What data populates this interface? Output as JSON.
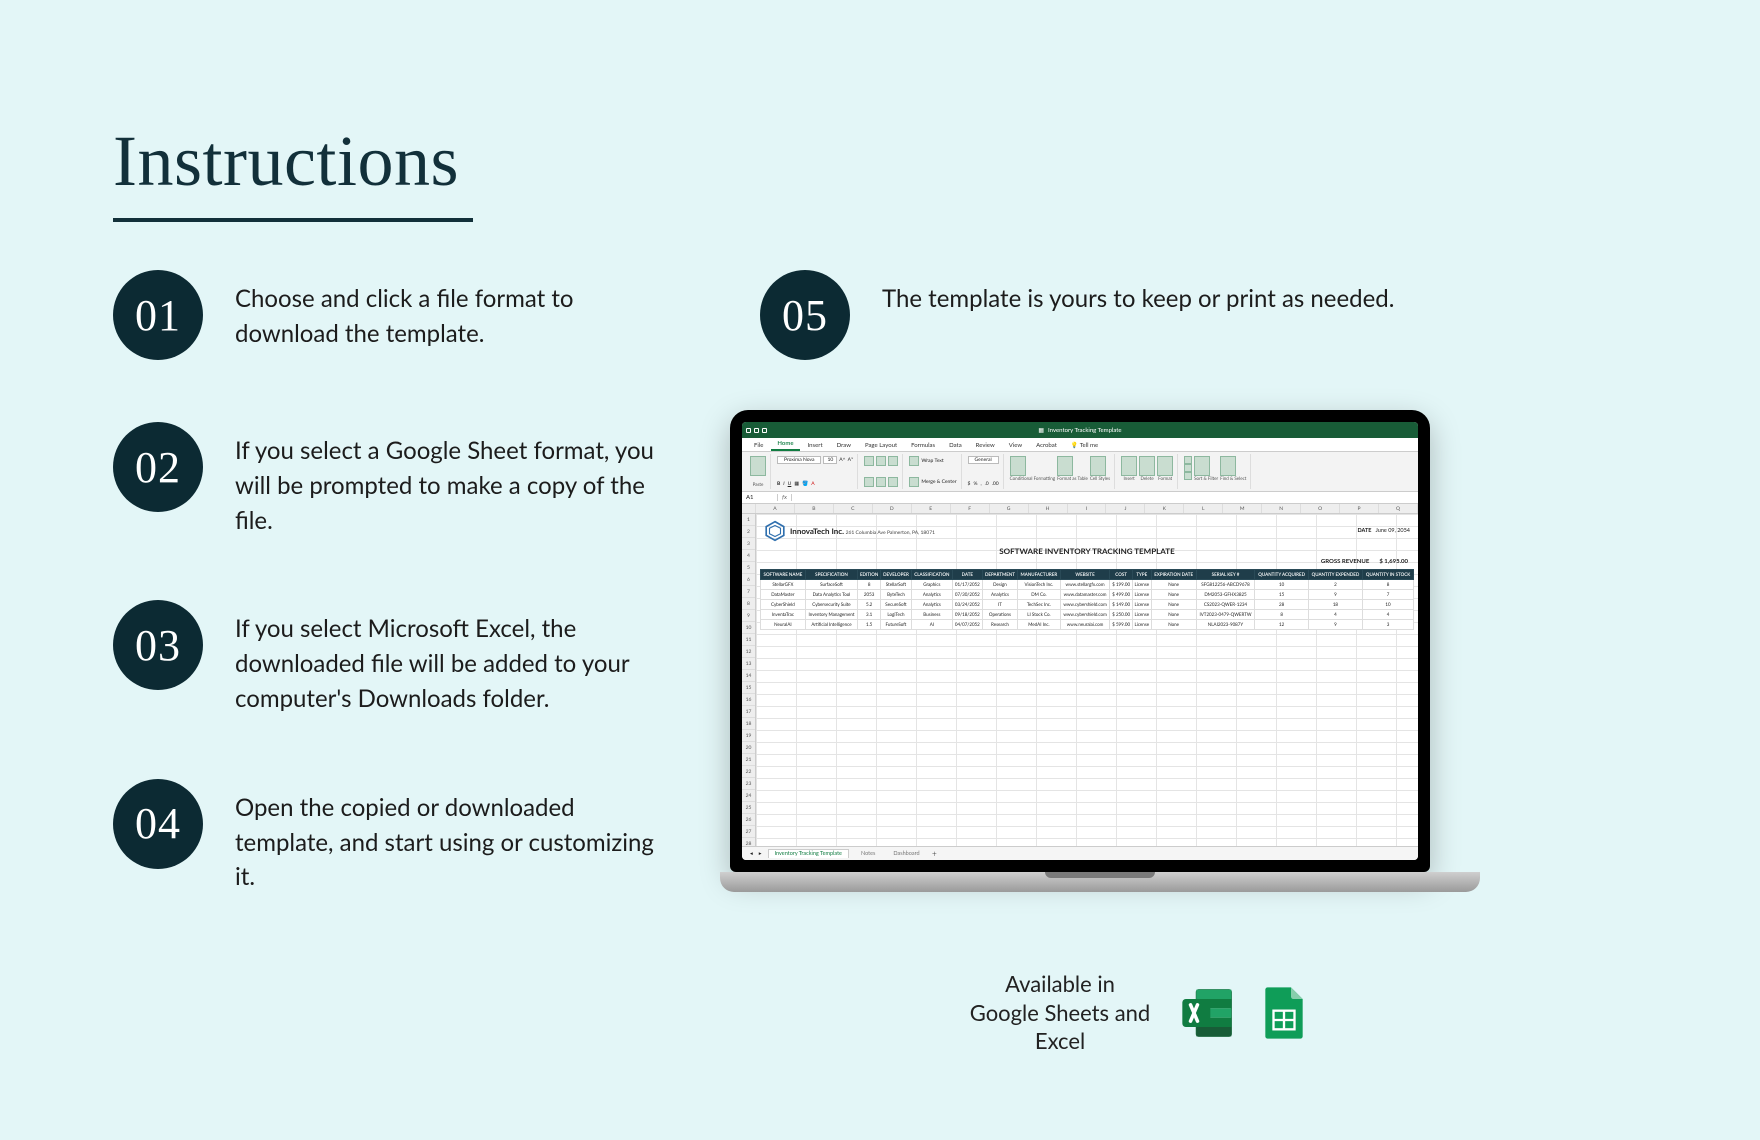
{
  "title": "Instructions",
  "steps": [
    {
      "num": "01",
      "text": "Choose and click a file format to download the template."
    },
    {
      "num": "02",
      "text": "If you select a Google Sheet format, you will be prompted to make a copy of the file."
    },
    {
      "num": "03",
      "text": "If you select Microsoft Excel, the downloaded file will be added to your computer's Downloads folder."
    },
    {
      "num": "04",
      "text": "Open the copied or downloaded template, and start using or customizing it."
    },
    {
      "num": "05",
      "text": "The template is yours to keep or print as needed."
    }
  ],
  "availability": {
    "text_line1": "Available in",
    "text_line2": "Google Sheets and Excel"
  },
  "excel": {
    "window_title": "Inventory Tracking Template",
    "tabs": [
      "File",
      "Home",
      "Insert",
      "Draw",
      "Page Layout",
      "Formulas",
      "Data",
      "Review",
      "View",
      "Acrobat"
    ],
    "tellme": "Tell me",
    "font_name": "Proxima Nova",
    "font_size": "10",
    "ribbon_labels": {
      "paste": "Paste",
      "wrap": "Wrap Text",
      "merge": "Merge & Center",
      "general": "General",
      "cond": "Conditional Formatting",
      "fmt_tbl": "Format as Table",
      "styles": "Cell Styles",
      "insert": "Insert",
      "delete": "Delete",
      "format": "Format",
      "sort": "Sort & Filter",
      "find": "Find & Select"
    },
    "name_box": "A1",
    "cols": [
      "A",
      "B",
      "C",
      "D",
      "E",
      "F",
      "G",
      "H",
      "I",
      "J",
      "K",
      "L",
      "M",
      "N",
      "O",
      "P",
      "Q"
    ],
    "sheet_tabs": [
      "Inventory Tracking Template",
      "Notes",
      "Dashboard"
    ],
    "doc": {
      "company": "InnovaTech Inc.",
      "address": "261 Columbia Ave Palmerton, PA, 18071",
      "date_label": "DATE",
      "date_value": "June 09, 2054",
      "title": "SOFTWARE INVENTORY TRACKING TEMPLATE",
      "gross_label": "GROSS REVENUE",
      "gross_value": "$    1,695.00",
      "headers": [
        "SOFTWARE NAME",
        "SPECIFICATION",
        "EDITION",
        "DEVELOPER",
        "CLASSIFICATION",
        "DATE",
        "DEPARTMENT",
        "MANUFACTURER",
        "WEBSITE",
        "COST",
        "TYPE",
        "EXPIRATION DATE",
        "SERIAL KEY #",
        "QUANTITY ACQUIRED",
        "QUANTITY EXPENDED",
        "QUANTITY IN STOCK"
      ],
      "rows": [
        [
          "StellarGFX",
          "SurfaceSoft",
          "8",
          "StellarSoft",
          "Graphics",
          "01/17/2052",
          "Design",
          "VisionTech Inc.",
          "www.stellargfx.com",
          "$ 199.00",
          "License",
          "None",
          "SFG812256-ABCD9678",
          "10",
          "2",
          "8"
        ],
        [
          "DataMaster",
          "Data Analytics Tool",
          "2053",
          "ByteTech",
          "Analytics",
          "07/30/2052",
          "Analytics",
          "DM Co.",
          "www.datamaster.com",
          "$ 499.00",
          "License",
          "None",
          "DM2053-GFHX3825",
          "15",
          "9",
          "7"
        ],
        [
          "CyberShield",
          "Cybersecurity Suite",
          "5.2",
          "SecureSoft",
          "Analytics",
          "03/24/2052",
          "IT",
          "TechSec Inc.",
          "www.cybershield.com",
          "$ 149.00",
          "License",
          "None",
          "CS2023-QWER-1234",
          "28",
          "18",
          "10"
        ],
        [
          "InventaTrac",
          "Inventory Management",
          "3.1",
          "LogiTech",
          "Business",
          "09/18/2052",
          "Operations",
          "LI Stock Co.",
          "www.cybershield.com",
          "$ 250.00",
          "License",
          "None",
          "IVT2023-0479-QWERTW",
          "8",
          "4",
          "4"
        ],
        [
          "NeuralAI",
          "Artificial Intelligence",
          "1.5",
          "FutureSoft",
          "AI",
          "04/07/2052",
          "Research",
          "MedAI Inc.",
          "www.neuralai.com",
          "$ 599.00",
          "License",
          "None",
          "NLAI2023-9087Y",
          "12",
          "9",
          "3"
        ]
      ]
    }
  }
}
